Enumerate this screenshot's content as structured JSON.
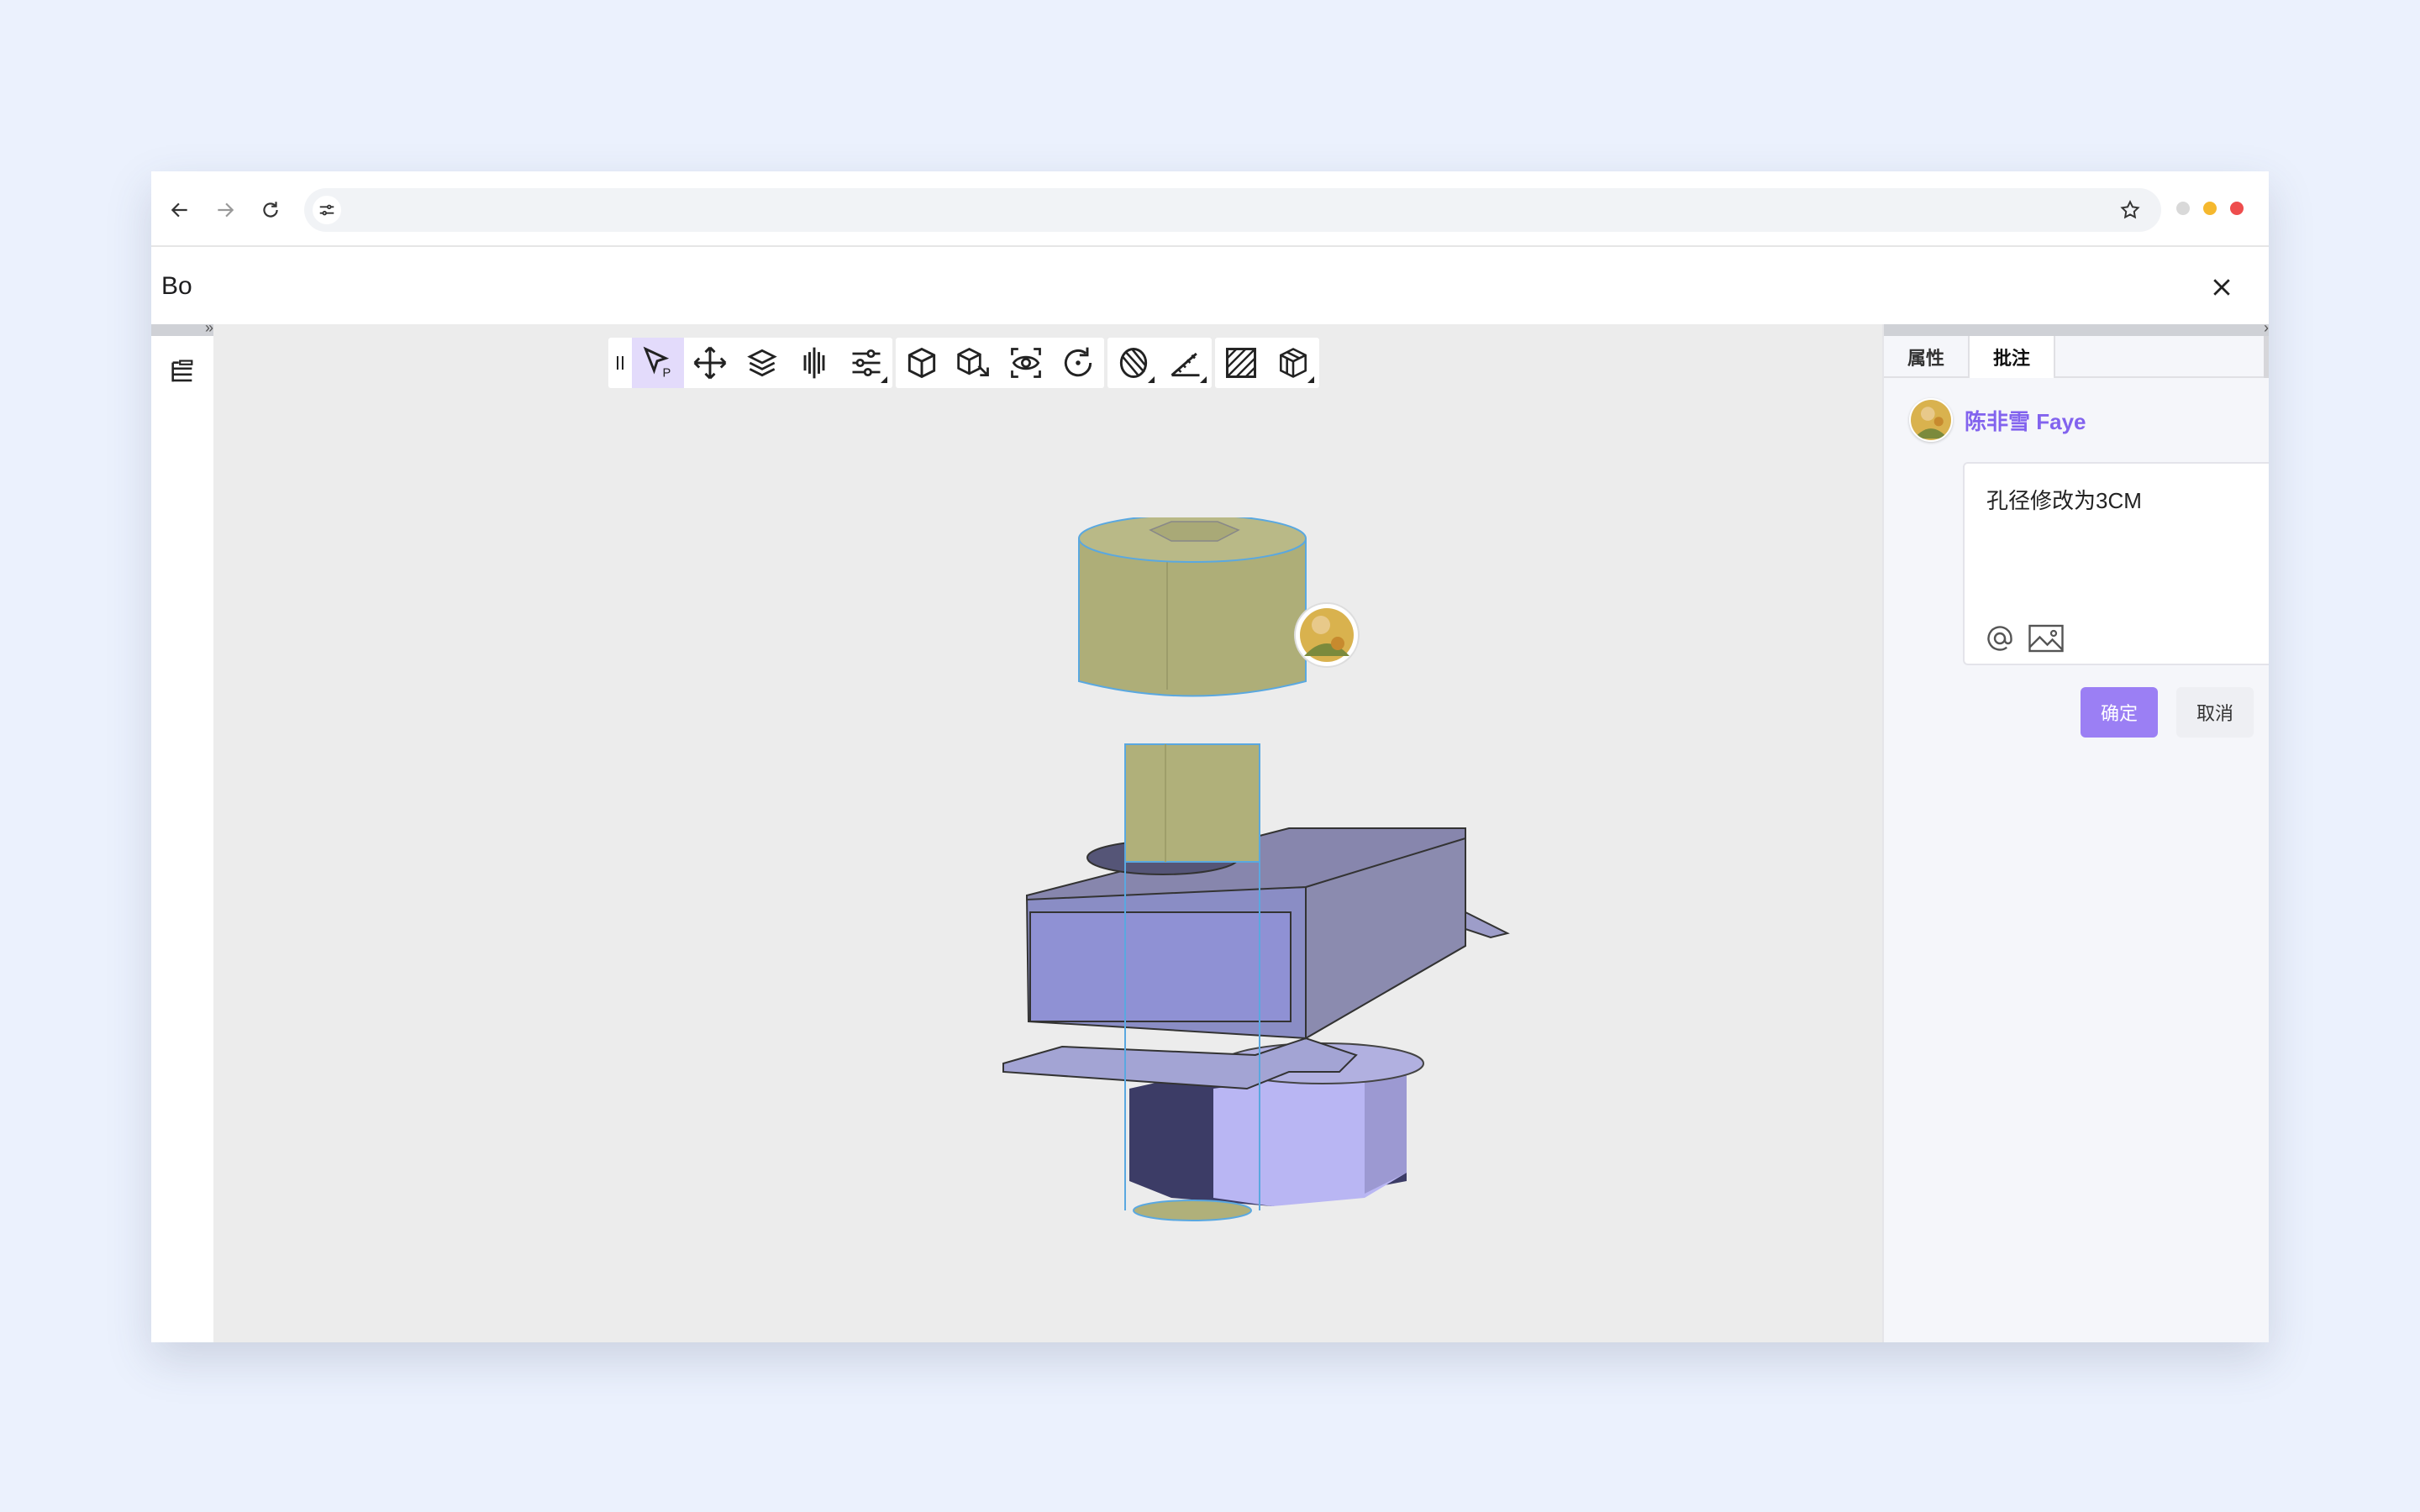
{
  "browser": {
    "icons": [
      "back-arrow-icon",
      "forward-arrow-icon",
      "reload-icon",
      "tune-icon",
      "star-icon"
    ],
    "window_dots": [
      "#d9d9d9",
      "#f5b82e",
      "#ee4d4d"
    ]
  },
  "app": {
    "title": "Bo"
  },
  "toolbar": {
    "groups": [
      [
        "grip-icon",
        "select-cursor-icon",
        "move-icon",
        "layers-icon",
        "align-icon",
        "adjust-sliders-icon"
      ],
      [
        "box-icon",
        "box-zoom-icon",
        "eye-scan-icon",
        "rotate-icon"
      ],
      [
        "section-icon",
        "measure-icon"
      ],
      [
        "hatch-icon",
        "explode-box-icon"
      ]
    ],
    "active": "select-cursor-icon"
  },
  "right_panel": {
    "tabs": [
      {
        "label": "属性"
      },
      {
        "label": "批注"
      }
    ],
    "active_tab": "批注",
    "comment": {
      "author": "陈非雪 Faye",
      "text": "孔径修改为3CM",
      "tools": [
        "at-icon",
        "image-icon"
      ]
    },
    "confirm_label": "确定",
    "cancel_label": "取消"
  },
  "colors": {
    "accent": "#8263ee",
    "button": "#9b7ff4",
    "bolt": "#b0b07a",
    "plate": "#8c8cb9"
  }
}
